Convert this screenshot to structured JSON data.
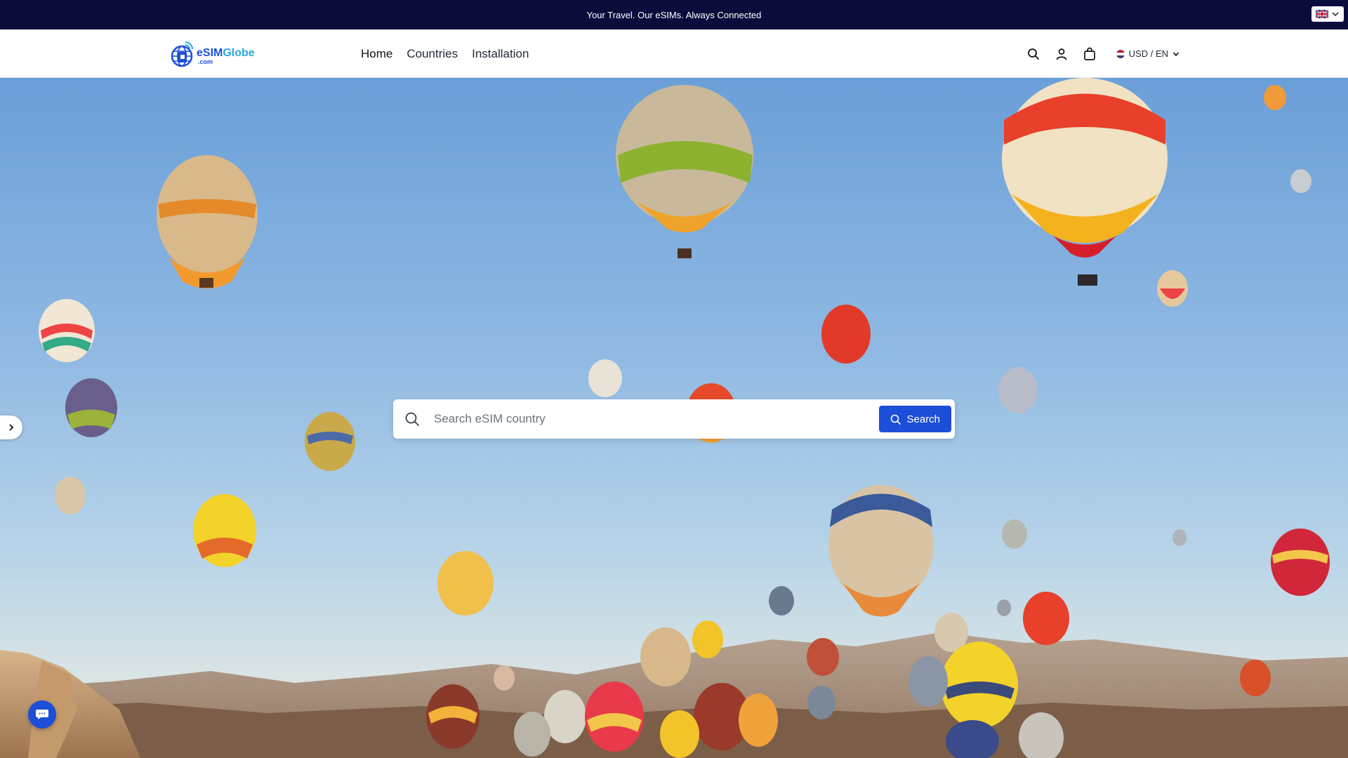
{
  "announcement": {
    "text": "Your Travel. Our eSIMs. Always Connected"
  },
  "language_switch": {
    "flag_icon": "uk-flag-icon"
  },
  "brand": {
    "name_part1": "eSIM",
    "name_part2": "Globe",
    "suffix": ".com",
    "color": "#1d4ed8"
  },
  "nav": {
    "items": [
      {
        "label": "Home"
      },
      {
        "label": "Countries"
      },
      {
        "label": "Installation"
      }
    ]
  },
  "header_tools": {
    "currency_label": "USD / EN",
    "icons": [
      "search-icon",
      "user-icon",
      "cart-icon",
      "chevron-down-icon"
    ]
  },
  "search": {
    "placeholder": "Search eSIM country",
    "value": "",
    "button_label": "Search"
  },
  "colors": {
    "accent": "#1d4ed8",
    "announcement_bg": "#0c0c3c"
  }
}
